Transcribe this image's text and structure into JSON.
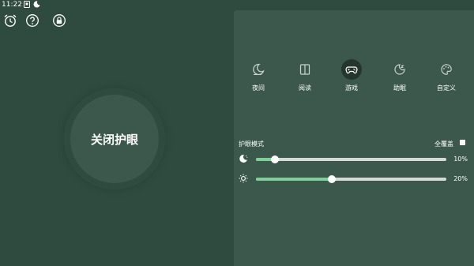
{
  "status_bar": {
    "time": "11:22"
  },
  "main_button": {
    "label": "关闭护眼"
  },
  "modes": [
    {
      "label": "夜间",
      "icon": "moon-icon",
      "active": false
    },
    {
      "label": "阅读",
      "icon": "book-icon",
      "active": false
    },
    {
      "label": "游戏",
      "icon": "gamepad-icon",
      "active": true
    },
    {
      "label": "助眠",
      "icon": "sleep-icon",
      "active": false
    },
    {
      "label": "自定义",
      "icon": "palette-icon",
      "active": false
    }
  ],
  "eye_mode": {
    "label": "护眼模式",
    "overlay_label": "全覆盖",
    "overlay_checked": true
  },
  "sliders": [
    {
      "icon": "moon-icon",
      "value_text": "10%",
      "value": 0.1
    },
    {
      "icon": "sun-icon",
      "value_text": "20%",
      "value": 0.4
    }
  ],
  "colors": {
    "background": "#2f4a3e",
    "panel": "#3c584d",
    "accent": "#7fcf9a"
  }
}
